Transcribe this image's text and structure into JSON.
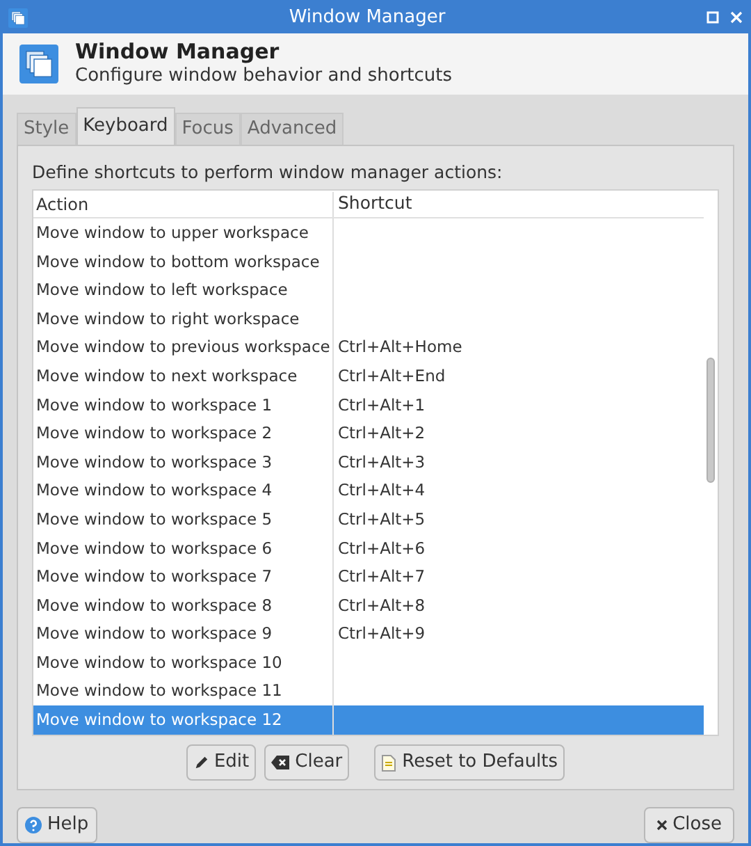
{
  "window": {
    "title": "Window Manager"
  },
  "header": {
    "title": "Window Manager",
    "subtitle": "Configure window behavior and shortcuts"
  },
  "tabs": [
    {
      "label": "Style",
      "selected": false
    },
    {
      "label": "Keyboard",
      "selected": true
    },
    {
      "label": "Focus",
      "selected": false
    },
    {
      "label": "Advanced",
      "selected": false
    }
  ],
  "description": "Define shortcuts to perform window manager actions:",
  "table": {
    "columns": [
      "Action",
      "Shortcut"
    ],
    "rows": [
      {
        "action": "Move window to upper workspace",
        "shortcut": "",
        "selected": false
      },
      {
        "action": "Move window to bottom workspace",
        "shortcut": "",
        "selected": false
      },
      {
        "action": "Move window to left workspace",
        "shortcut": "",
        "selected": false
      },
      {
        "action": "Move window to right workspace",
        "shortcut": "",
        "selected": false
      },
      {
        "action": "Move window to previous workspace",
        "shortcut": "Ctrl+Alt+Home",
        "selected": false
      },
      {
        "action": "Move window to next workspace",
        "shortcut": "Ctrl+Alt+End",
        "selected": false
      },
      {
        "action": "Move window to workspace 1",
        "shortcut": "Ctrl+Alt+1",
        "selected": false
      },
      {
        "action": "Move window to workspace 2",
        "shortcut": "Ctrl+Alt+2",
        "selected": false
      },
      {
        "action": "Move window to workspace 3",
        "shortcut": "Ctrl+Alt+3",
        "selected": false
      },
      {
        "action": "Move window to workspace 4",
        "shortcut": "Ctrl+Alt+4",
        "selected": false
      },
      {
        "action": "Move window to workspace 5",
        "shortcut": "Ctrl+Alt+5",
        "selected": false
      },
      {
        "action": "Move window to workspace 6",
        "shortcut": "Ctrl+Alt+6",
        "selected": false
      },
      {
        "action": "Move window to workspace 7",
        "shortcut": "Ctrl+Alt+7",
        "selected": false
      },
      {
        "action": "Move window to workspace 8",
        "shortcut": "Ctrl+Alt+8",
        "selected": false
      },
      {
        "action": "Move window to workspace 9",
        "shortcut": "Ctrl+Alt+9",
        "selected": false
      },
      {
        "action": "Move window to workspace 10",
        "shortcut": "",
        "selected": false
      },
      {
        "action": "Move window to workspace 11",
        "shortcut": "",
        "selected": false
      },
      {
        "action": "Move window to workspace 12",
        "shortcut": "",
        "selected": true
      }
    ]
  },
  "actions": [
    "Edit",
    "Clear",
    "Reset to Defaults"
  ],
  "footer": {
    "help": "Help",
    "close": "Close"
  }
}
